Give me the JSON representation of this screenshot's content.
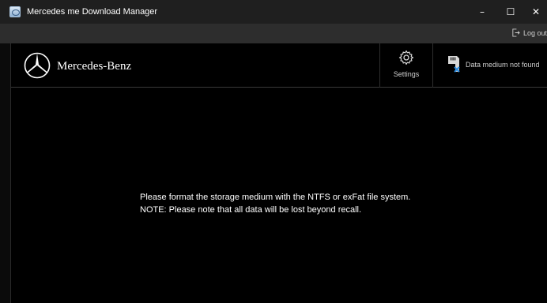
{
  "window": {
    "title": "Mercedes me Download Manager",
    "minimize_label": "–",
    "maximize_label": "☐",
    "close_label": "✕"
  },
  "toolbar": {
    "logout_label": "Log out",
    "logout_icon": "logout-icon"
  },
  "header": {
    "brand_name": "Mercedes-Benz",
    "logo_icon": "mercedes-star-icon",
    "settings_label": "Settings",
    "settings_icon": "gear-icon",
    "data_medium_label": "Data medium not found",
    "data_medium_icon": "sd-card-error-icon"
  },
  "main": {
    "message_line1": "Please format the storage medium with the NTFS or exFat file system.",
    "message_line2": "NOTE: Please note that all data will be lost beyond recall."
  },
  "colors": {
    "background": "#000000",
    "titlebar": "#1f1f1f",
    "strip": "#2d2d2d",
    "error_accent": "#2a8be0"
  }
}
